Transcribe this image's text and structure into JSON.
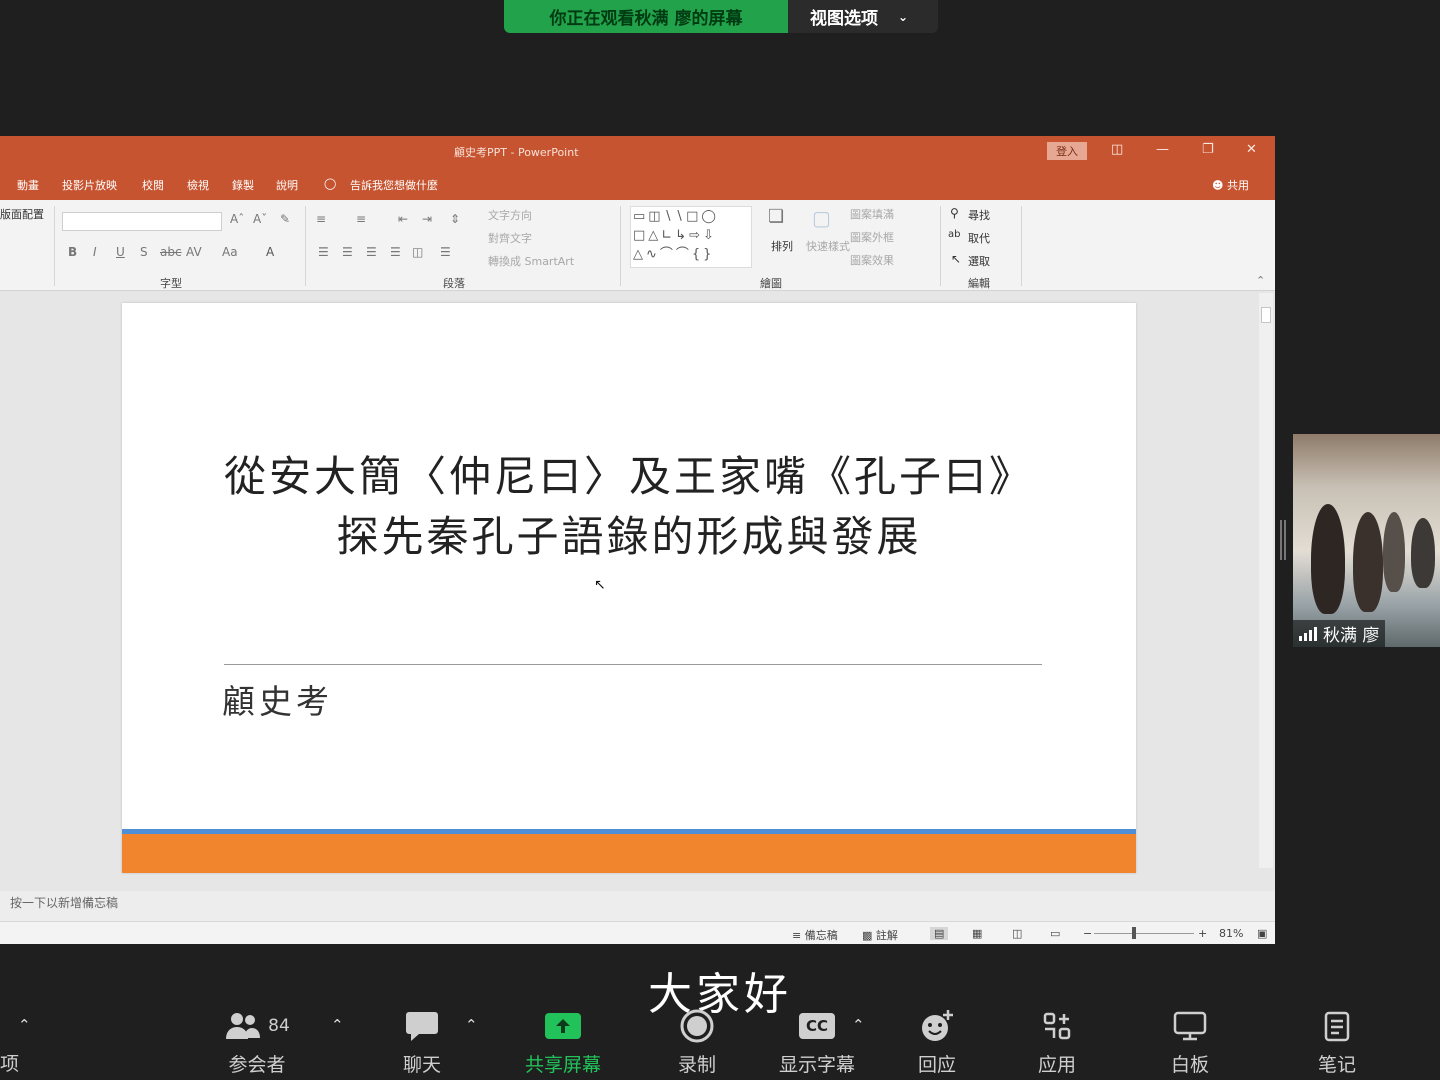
{
  "zoom": {
    "share_status": "你正在观看秋满 廖的屏幕",
    "view_options": "视图选项",
    "caption": "大家好",
    "participant": {
      "name": "秋满 廖"
    },
    "toolbar": {
      "left_partial_label": "项",
      "participants_label": "参会者",
      "participants_count": "84",
      "chat_label": "聊天",
      "share_label": "共享屏幕",
      "record_label": "录制",
      "captions_label": "显示字幕",
      "captions_icon_text": "CC",
      "react_label": "回应",
      "apps_label": "应用",
      "whiteboard_label": "白板",
      "notes_label": "笔记"
    }
  },
  "powerpoint": {
    "window_title": "顧史考PPT  -  PowerPoint",
    "login_button": "登入",
    "share_link": "共用",
    "menu": [
      "動畫",
      "投影片放映",
      "校閱",
      "檢視",
      "錄製",
      "說明"
    ],
    "tell_me": "告訴我您想做什麼",
    "ribbon": {
      "slide_section_partial": "版面配置",
      "font_group": "字型",
      "paragraph_group": "段落",
      "drawing_group": "繪圖",
      "editing_group": "編輯",
      "text_direction": "文字方向",
      "align_text": "對齊文字",
      "convert_smartart": "轉換成 SmartArt",
      "arrange": "排列",
      "quick_styles": "快速樣式",
      "shape_fill": "圖案填滿",
      "shape_outline": "圖案外框",
      "shape_effects": "圖案效果",
      "find": "尋找",
      "replace": "取代",
      "select": "選取"
    },
    "slide": {
      "title_line1": "從安大簡〈仲尼曰〉及王家嘴《孔子曰》",
      "title_line2": "探先秦孔子語錄的形成與發展",
      "author": "顧史考"
    },
    "notes_placeholder": "按一下以新增備忘稿",
    "status": {
      "notes_button": "備忘稿",
      "comments_button": "註解",
      "zoom_level": "81%"
    },
    "colors": {
      "titlebar": "#c75430",
      "slide_band_orange": "#f0852d",
      "slide_band_blue": "#4f8fd6",
      "zoom_green": "#22a24b"
    }
  }
}
